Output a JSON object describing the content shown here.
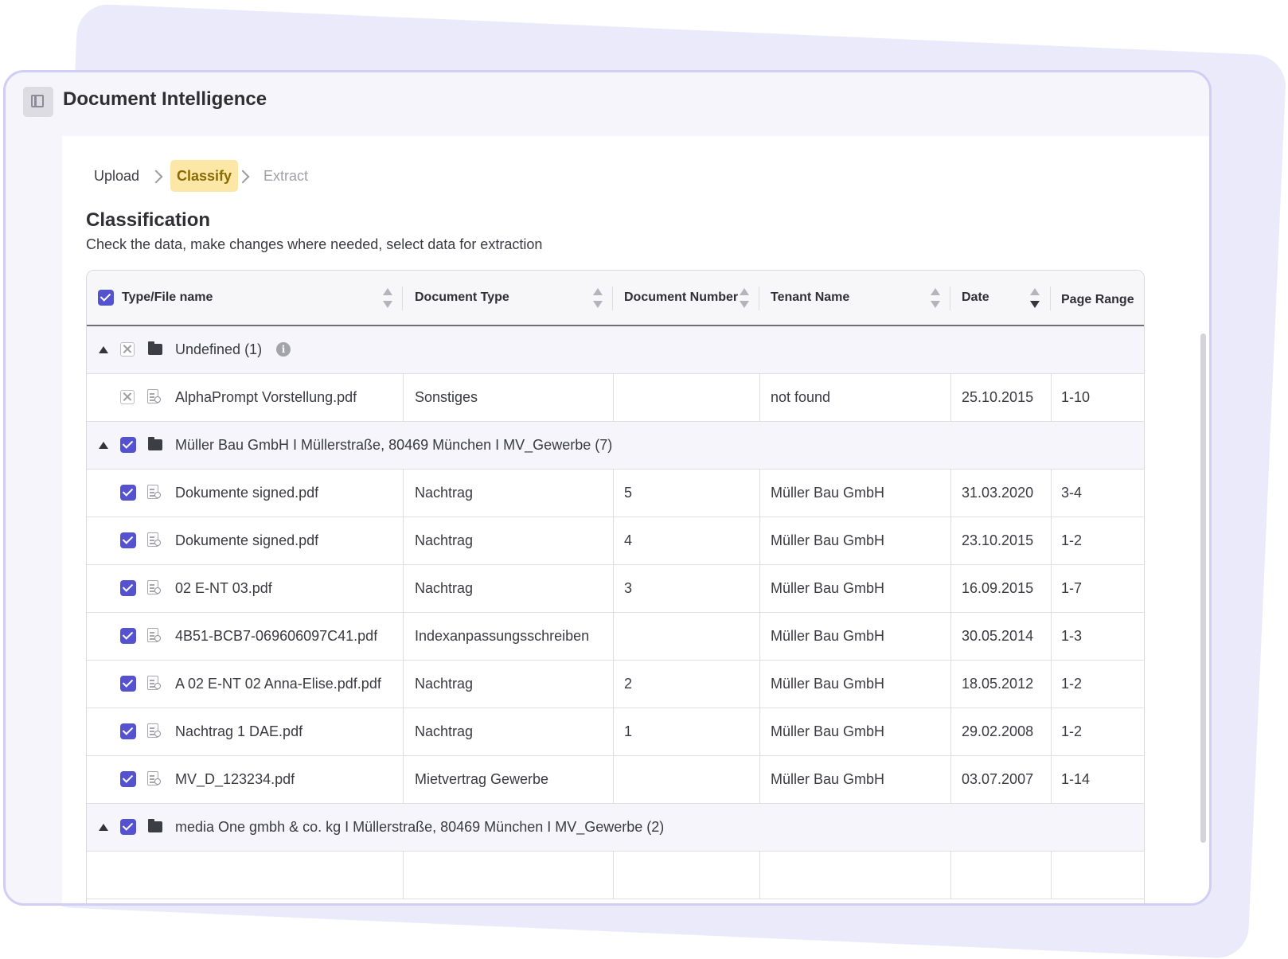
{
  "app": {
    "title": "Document Intelligence"
  },
  "stepper": {
    "steps": [
      "Upload",
      "Classify",
      "Extract"
    ],
    "active": "Classify"
  },
  "section": {
    "title": "Classification",
    "subtitle": "Check the data, make changes where needed, select data for extraction"
  },
  "table": {
    "columns": [
      "Type/File name",
      "Document Type",
      "Document Number",
      "Tenant Name",
      "Date",
      "Page Range"
    ],
    "groups": [
      {
        "label": "Undefined (1)",
        "checked": false,
        "expanded": true,
        "rows": [
          {
            "file": "AlphaPrompt Vorstellung.pdf",
            "type": "Sonstiges",
            "number": "",
            "tenant": "not found",
            "date": "25.10.2015",
            "pages": "1-10",
            "checked": false
          }
        ]
      },
      {
        "label": "Müller Bau GmbH I Müllerstraße, 80469 München I MV_Gewerbe (7)",
        "checked": true,
        "expanded": true,
        "rows": [
          {
            "file": "Dokumente signed.pdf",
            "type": "Nachtrag",
            "number": "5",
            "tenant": "Müller Bau GmbH",
            "date": "31.03.2020",
            "pages": "3-4",
            "checked": true
          },
          {
            "file": "Dokumente signed.pdf",
            "type": "Nachtrag",
            "number": "4",
            "tenant": "Müller Bau GmbH",
            "date": "23.10.2015",
            "pages": "1-2",
            "checked": true
          },
          {
            "file": "02 E-NT 03.pdf",
            "type": "Nachtrag",
            "number": "3",
            "tenant": "Müller Bau GmbH",
            "date": "16.09.2015",
            "pages": "1-7",
            "checked": true
          },
          {
            "file": "4B51-BCB7-069606097C41.pdf",
            "type": "Indexanpassungsschreiben",
            "number": "",
            "tenant": "Müller Bau GmbH",
            "date": "30.05.2014",
            "pages": "1-3",
            "checked": true
          },
          {
            "file": "A 02 E-NT 02 Anna-Elise.pdf.pdf",
            "type": "Nachtrag",
            "number": "2",
            "tenant": "Müller Bau GmbH",
            "date": "18.05.2012",
            "pages": "1-2",
            "checked": true
          },
          {
            "file": "Nachtrag 1 DAE.pdf",
            "type": "Nachtrag",
            "number": "1",
            "tenant": "Müller Bau GmbH",
            "date": "29.02.2008",
            "pages": "1-2",
            "checked": true
          },
          {
            "file": "MV_D_123234.pdf",
            "type": "Mietvertrag Gewerbe",
            "number": "",
            "tenant": "Müller Bau GmbH",
            "date": "03.07.2007",
            "pages": "1-14",
            "checked": true
          }
        ]
      },
      {
        "label": "media One gmbh & co. kg I Müllerstraße, 80469 München I MV_Gewerbe (2)",
        "checked": true,
        "expanded": true,
        "rows": []
      }
    ]
  },
  "colors": {
    "accent": "#5552d0",
    "active_step_bg": "#fde7a6",
    "active_step_text": "#8a6a05",
    "frame": "#d2cdf4"
  }
}
